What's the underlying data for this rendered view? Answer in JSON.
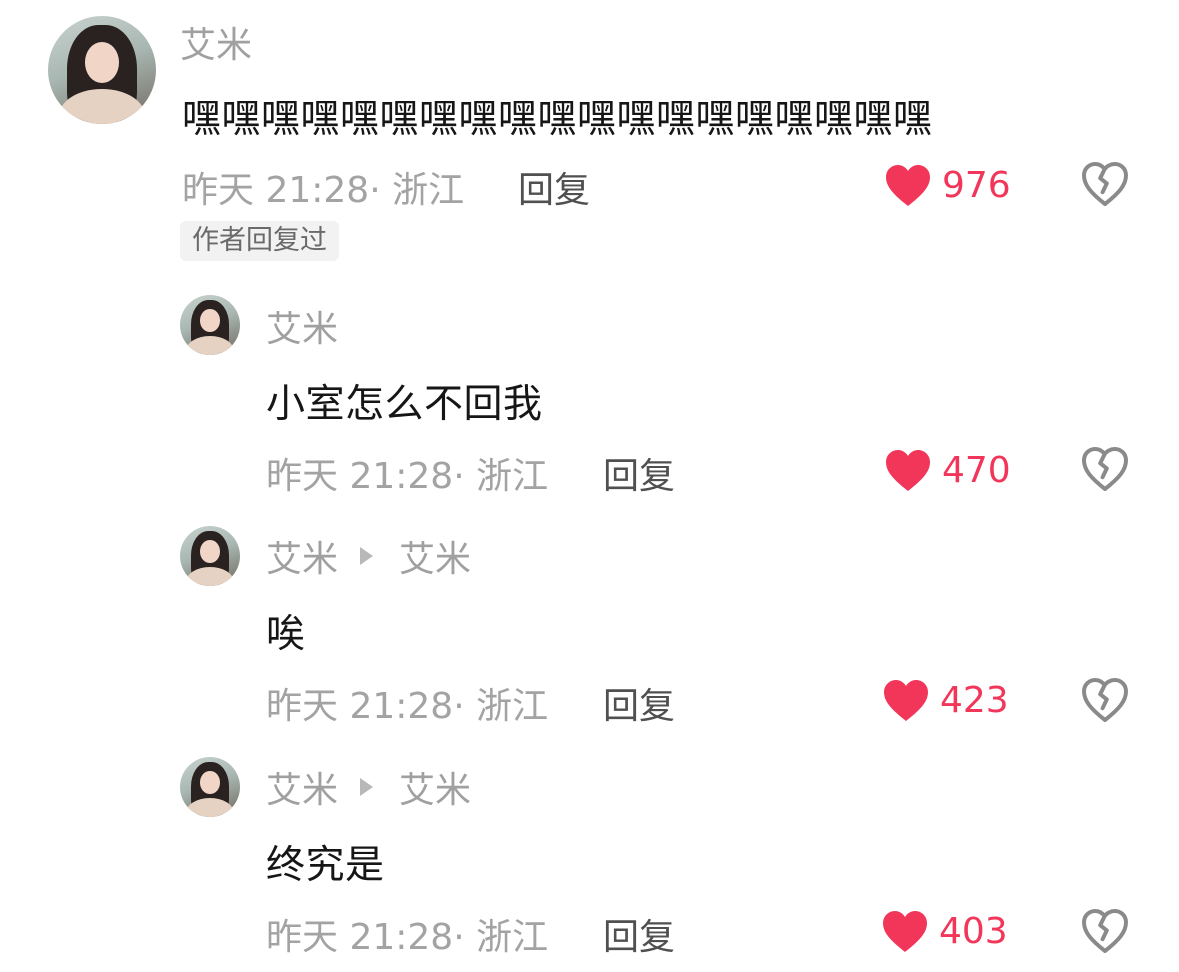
{
  "comments": [
    {
      "author": "艾米",
      "reply_to": "",
      "text": "嘿嘿嘿嘿嘿嘿嘿嘿嘿嘿嘿嘿嘿嘿嘿嘿嘿嘿嘿",
      "time_location": "昨天 21:28· 浙江",
      "reply_label": "回复",
      "likes": "976",
      "badge": "作者回复过"
    },
    {
      "author": "艾米",
      "reply_to": "",
      "text": "小室怎么不回我",
      "time_location": "昨天 21:28· 浙江",
      "reply_label": "回复",
      "likes": "470"
    },
    {
      "author": "艾米",
      "reply_to": "艾米",
      "text": "唉",
      "time_location": "昨天 21:28· 浙江",
      "reply_label": "回复",
      "likes": "423"
    },
    {
      "author": "艾米",
      "reply_to": "艾米",
      "text": "终究是",
      "time_location": "昨天 21:28· 浙江",
      "reply_label": "回复",
      "likes": "403"
    }
  ],
  "icons": {
    "like": "heart-icon",
    "dislike": "broken-heart-icon",
    "reply_arrow": "play-arrow-icon"
  },
  "colors": {
    "like": "#f2365a",
    "meta_text": "#a3a3a3",
    "body_text": "#161616"
  }
}
